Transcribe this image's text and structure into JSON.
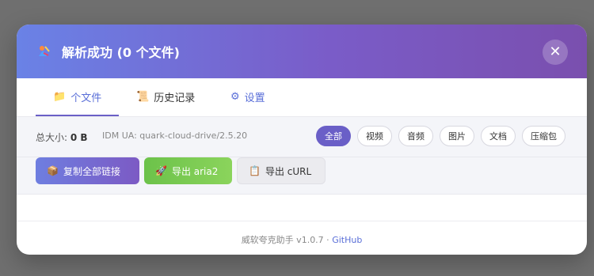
{
  "header": {
    "title": "解析成功 (0 个文件)",
    "close_glyph": "✕"
  },
  "tabs": [
    {
      "label": "个文件",
      "icon": "folder-icon"
    },
    {
      "label": "历史记录",
      "icon": "scroll-icon"
    },
    {
      "label": "设置",
      "icon": "gear-icon"
    }
  ],
  "stats": {
    "total_label": "总大小:",
    "total_value": "0 B",
    "ua": "IDM UA: quark-cloud-drive/2.5.20"
  },
  "filters": [
    "全部",
    "视频",
    "音频",
    "图片",
    "文档",
    "压缩包"
  ],
  "actions": {
    "copy": "复制全部链接",
    "aria": "导出 aria2",
    "curl": "导出 cURL"
  },
  "footer": {
    "text": "威软夸克助手 v1.0.7 · ",
    "link": "GitHub"
  },
  "colors": {
    "accent": "#6a5fc7",
    "green": "#7ccb52"
  }
}
